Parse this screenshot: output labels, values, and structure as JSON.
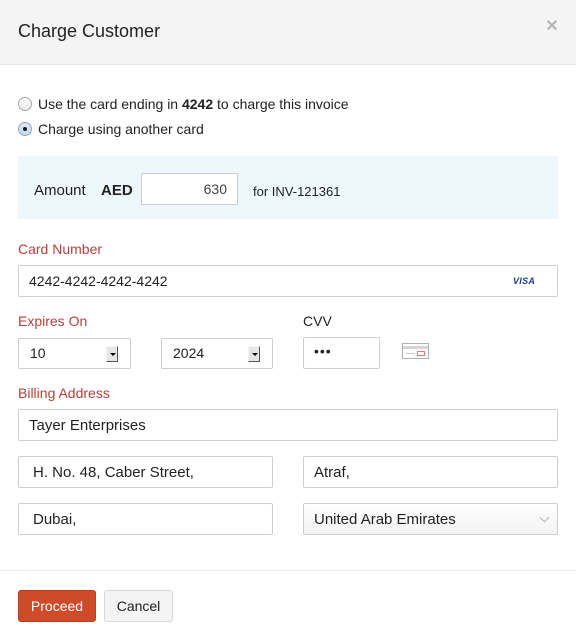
{
  "dialog": {
    "title": "Charge Customer",
    "close_icon": "close-icon"
  },
  "payment_option": {
    "saved_card": {
      "prefix": "Use the card ending in ",
      "last4": "4242",
      "suffix": " to charge this invoice",
      "selected": false
    },
    "another_card": {
      "label": "Charge using another card",
      "selected": true
    }
  },
  "amount": {
    "label": "Amount",
    "currency": "AED",
    "value": "630",
    "invoice_text": "for INV-121361"
  },
  "card": {
    "number_label": "Card Number",
    "number_value": "4242-4242-4242-4242",
    "brand": "VISA",
    "expires_label": "Expires On",
    "expiry_month": "10",
    "expiry_year": "2024",
    "cvv_label": "CVV",
    "cvv_value": "•••",
    "cvv_help_icon": "card-cvv-icon"
  },
  "billing": {
    "label": "Billing Address",
    "name": "Tayer Enterprises",
    "street": "H. No. 48, Caber Street,",
    "area": "Atraf,",
    "city": "Dubai,",
    "country": "United Arab Emirates"
  },
  "footer": {
    "proceed_label": "Proceed",
    "cancel_label": "Cancel"
  },
  "colors": {
    "accent": "#cf4a29",
    "label_red": "#b5413a",
    "amount_bg": "#eef7fb",
    "header_bg": "#f4f4f4"
  }
}
